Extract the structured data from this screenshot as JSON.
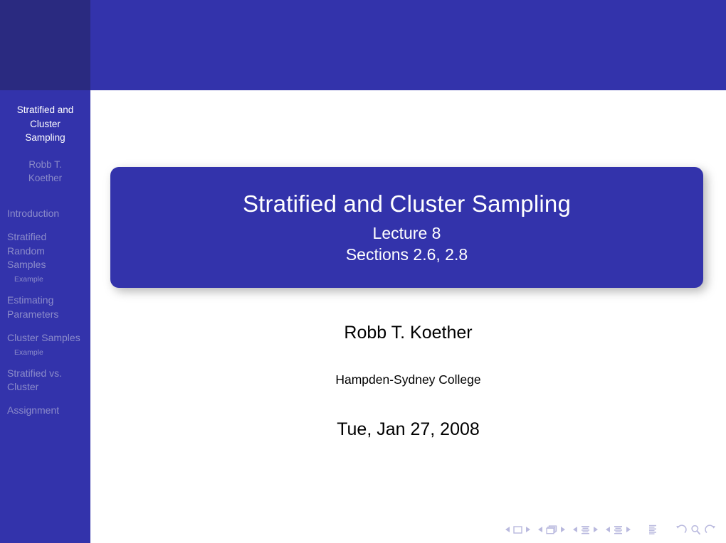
{
  "slide": {
    "kind": "beamer-title-slide",
    "theme_colors": {
      "primary": "#3333ab",
      "header_dark": "#2a2a80",
      "sidebar_inactive_text": "#8c8cca",
      "sidebar_active_text": "#ffffff",
      "body_text": "#000000",
      "nav_symbol": "#b9b9de"
    }
  },
  "sidebar": {
    "title_lines": [
      "Stratified and",
      "Cluster",
      "Sampling"
    ],
    "author_lines": [
      "Robb T.",
      "Koether"
    ],
    "entries": [
      {
        "label": "Introduction",
        "type": "section"
      },
      {
        "label": "Stratified Random Samples",
        "type": "section"
      },
      {
        "label": "Example",
        "type": "subsection"
      },
      {
        "label": "Estimating Parameters",
        "type": "section"
      },
      {
        "label": "Cluster Samples",
        "type": "section"
      },
      {
        "label": "Example",
        "type": "subsection"
      },
      {
        "label": "Stratified vs. Cluster",
        "type": "section"
      },
      {
        "label": "Assignment",
        "type": "section"
      }
    ]
  },
  "title_block": {
    "title": "Stratified and Cluster Sampling",
    "subtitle_lines": [
      "Lecture 8",
      "Sections 2.6, 2.8"
    ]
  },
  "author_block": {
    "author": "Robb T. Koether",
    "institute": "Hampden-Sydney College",
    "date": "Tue, Jan 27, 2008"
  },
  "navigation_symbols": {
    "groups": [
      {
        "name": "slide-nav",
        "icons": [
          "prev-triangle-icon",
          "slide-icon",
          "next-triangle-icon"
        ]
      },
      {
        "name": "frame-nav",
        "icons": [
          "prev-triangle-icon",
          "frames-icon",
          "next-triangle-icon"
        ]
      },
      {
        "name": "subsection-nav",
        "icons": [
          "prev-triangle-icon",
          "subsection-icon",
          "next-triangle-icon"
        ]
      },
      {
        "name": "section-nav",
        "icons": [
          "prev-triangle-icon",
          "section-icon",
          "next-triangle-icon"
        ]
      },
      {
        "name": "doc-nav",
        "icons": [
          "document-icon"
        ]
      },
      {
        "name": "view-nav",
        "icons": [
          "back-icon",
          "search-icon",
          "forward-icon"
        ]
      }
    ]
  }
}
